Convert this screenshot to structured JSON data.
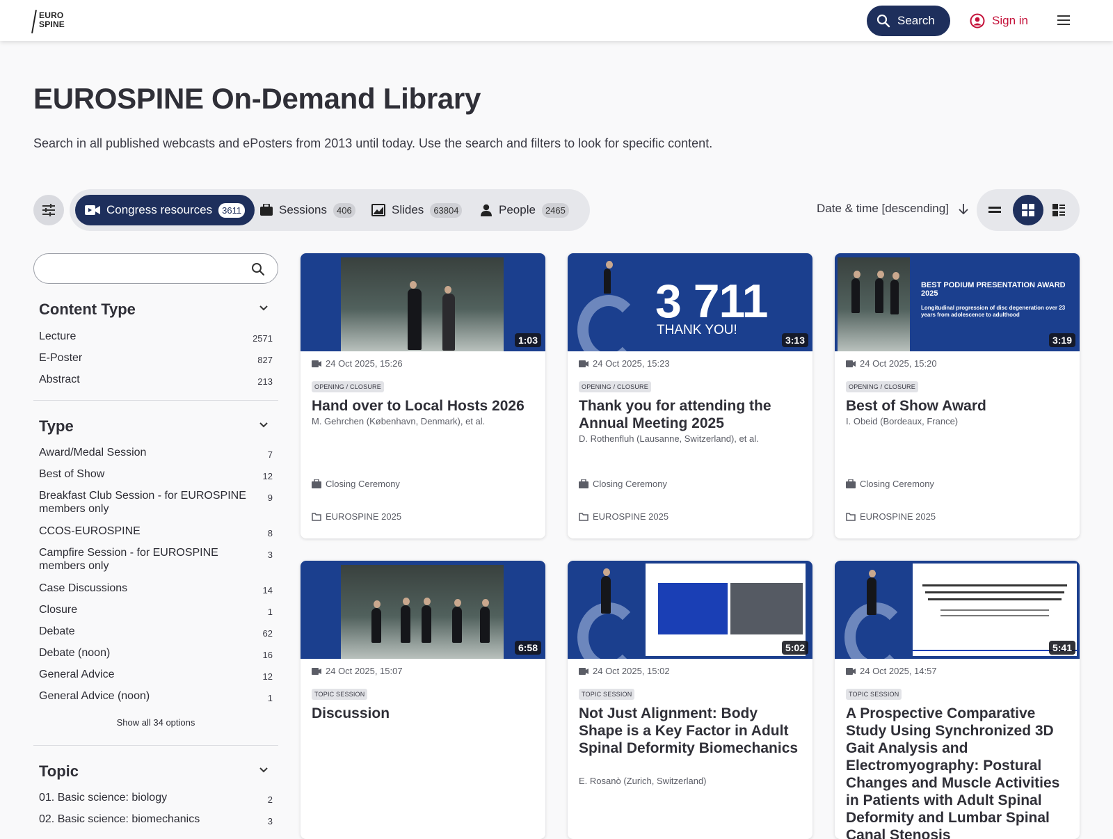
{
  "header": {
    "logo_line1": "EURO",
    "logo_line2": "SPINE",
    "search_label": "Search",
    "signin_label": "Sign in"
  },
  "page": {
    "title": "EUROSPINE On-Demand Library",
    "description": "Search in all published webcasts and ePosters from 2013 until today. Use the search and filters to look for specific content."
  },
  "tabs": [
    {
      "label": "Congress resources",
      "count": "3611",
      "icon": "video-icon",
      "active": true
    },
    {
      "label": "Sessions",
      "count": "406",
      "icon": "briefcase-icon",
      "active": false
    },
    {
      "label": "Slides",
      "count": "63804",
      "icon": "slides-icon",
      "active": false
    },
    {
      "label": "People",
      "count": "2465",
      "icon": "person-icon",
      "active": false
    }
  ],
  "sort": {
    "label": "Date & time [descending]"
  },
  "sidebar": {
    "search_placeholder": "",
    "content_type": {
      "title": "Content Type",
      "items": [
        {
          "label": "Lecture",
          "count": "2571"
        },
        {
          "label": "E-Poster",
          "count": "827"
        },
        {
          "label": "Abstract",
          "count": "213"
        }
      ]
    },
    "type": {
      "title": "Type",
      "items": [
        {
          "label": "Award/Medal Session",
          "count": "7"
        },
        {
          "label": "Best of Show",
          "count": "12"
        },
        {
          "label": "Breakfast Club Session - for EUROSPINE members only",
          "count": "9"
        },
        {
          "label": "CCOS-EUROSPINE",
          "count": "8"
        },
        {
          "label": "Campfire Session - for EUROSPINE members only",
          "count": "3"
        },
        {
          "label": "Case Discussions",
          "count": "14"
        },
        {
          "label": "Closure",
          "count": "1"
        },
        {
          "label": "Debate",
          "count": "62"
        },
        {
          "label": "Debate (noon)",
          "count": "16"
        },
        {
          "label": "General Advice",
          "count": "12"
        },
        {
          "label": "General Advice (noon)",
          "count": "1"
        }
      ],
      "show_all": "Show all 34 options"
    },
    "topic": {
      "title": "Topic",
      "items": [
        {
          "label": "01. Basic science: biology",
          "count": "2"
        },
        {
          "label": "02. Basic science: biomechanics",
          "count": "3"
        }
      ]
    }
  },
  "cards": [
    {
      "duration": "1:03",
      "datetime": "24 Oct 2025, 15:26",
      "badge": "OPENING / CLOSURE",
      "title": "Hand over to Local Hosts 2026",
      "authors": "M. Gehrchen (København, Denmark), et al.",
      "session": "Closing Ceremony",
      "event": "EUROSPINE 2025"
    },
    {
      "duration": "3:13",
      "datetime": "24 Oct 2025, 15:23",
      "badge": "OPENING / CLOSURE",
      "title": "Thank you for attending the Annual Meeting 2025",
      "authors": "D. Rothenfluh (Lausanne, Switzerland), et al.",
      "session": "Closing Ceremony",
      "event": "EUROSPINE 2025",
      "thumb_big": "3 711",
      "thumb_sub": "THANK YOU!"
    },
    {
      "duration": "3:19",
      "datetime": "24 Oct 2025, 15:20",
      "badge": "OPENING / CLOSURE",
      "title": "Best of Show Award",
      "authors": "I. Obeid (Bordeaux, France)",
      "session": "Closing Ceremony",
      "event": "EUROSPINE 2025",
      "thumb_big": "BEST PODIUM PRESENTATION AWARD 2025",
      "thumb_sub": "Longitudinal progression of disc degeneration over 23 years from adolescence to adulthood"
    },
    {
      "duration": "6:58",
      "datetime": "24 Oct 2025, 15:07",
      "badge": "TOPIC SESSION",
      "title": "Discussion",
      "authors": ""
    },
    {
      "duration": "5:02",
      "datetime": "24 Oct 2025, 15:02",
      "badge": "TOPIC SESSION",
      "title": "Not Just Alignment: Body Shape is a Key Factor in Adult Spinal Deformity Biomechanics",
      "authors": "E. Rosanò (Zurich, Switzerland)"
    },
    {
      "duration": "5:41",
      "datetime": "24 Oct 2025, 14:57",
      "badge": "TOPIC SESSION",
      "title": "A Prospective Comparative Study Using Synchronized 3D Gait Analysis and Electromyography: Postural Changes and Muscle Activities in Patients with Adult Spinal Deformity and Lumbar Spinal Canal Stenosis",
      "authors": ""
    }
  ]
}
